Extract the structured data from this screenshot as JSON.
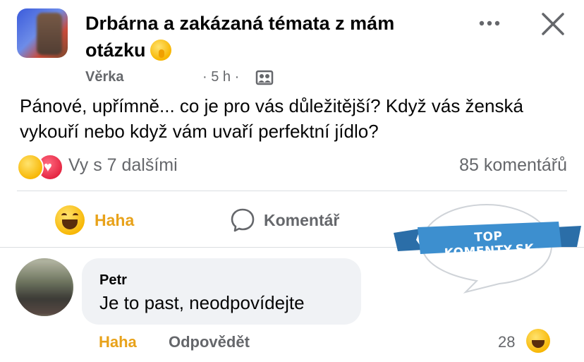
{
  "post": {
    "group_title": "Drbárna a zakázaná témata z mám otázku",
    "author": "Věrka",
    "time": "· 5 h ·",
    "text": "Pánové, upřímně... co je pro vás důležitější? Když vás ženská vykouří nebo když vám uvaří perfektní jídlo?",
    "reactions_text": "Vy s 7 dalšími",
    "comments_count": "85 komentářů"
  },
  "actions": {
    "haha_label": "Haha",
    "comment_label": "Komentář"
  },
  "watermark": {
    "text": "TOP KOMENTY.SK"
  },
  "comment": {
    "author": "Petr",
    "text": "Je to past, neodpovídejte",
    "haha_label": "Haha",
    "reply_label": "Odpovědět",
    "reaction_count": "28"
  },
  "colors": {
    "haha_accent": "#e8a21a",
    "secondary_text": "#65676b",
    "bubble_bg": "#f0f2f5",
    "watermark_blue": "#3d8fcf"
  },
  "icons": [
    "more-icon",
    "close-icon",
    "group-icon",
    "haha-icon",
    "love-icon",
    "comment-icon"
  ]
}
